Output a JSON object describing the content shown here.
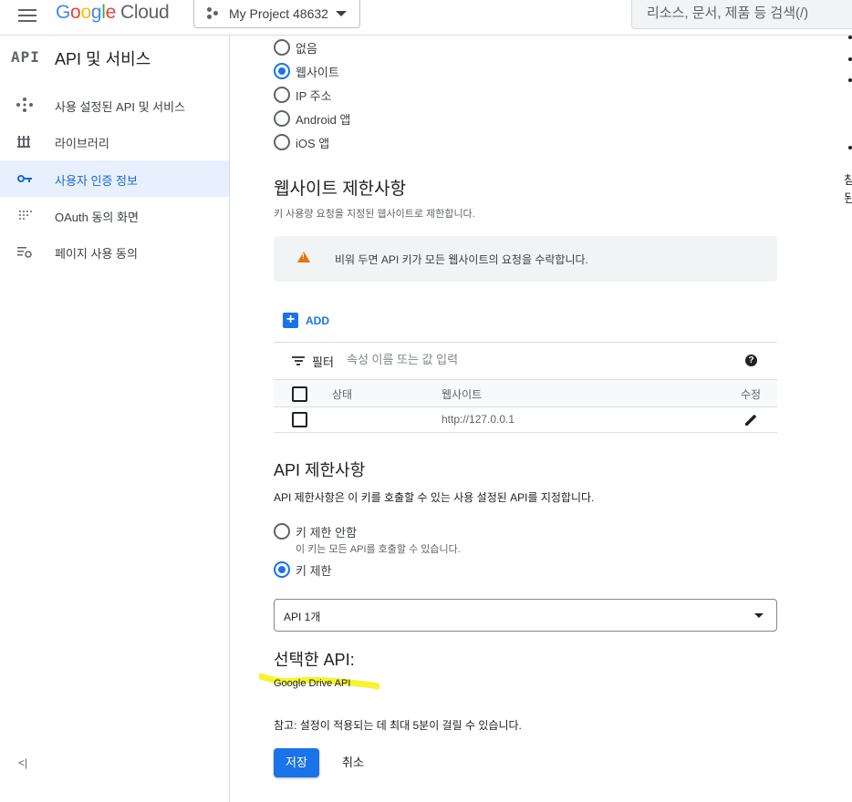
{
  "header": {
    "logo_google": [
      "G",
      "o",
      "o",
      "g",
      "l",
      "e"
    ],
    "logo_cloud": "Cloud",
    "project_name": "My Project 48632",
    "search_placeholder": "리소스, 문서, 제품 등 검색(/)"
  },
  "sidebar": {
    "badge": "API",
    "title": "API 및 서비스",
    "items": [
      {
        "label": "사용 설정된 API 및 서비스",
        "icon": "diamond-dots-icon"
      },
      {
        "label": "라이브러리",
        "icon": "library-icon"
      },
      {
        "label": "사용자 인증 정보",
        "icon": "key-icon",
        "active": true
      },
      {
        "label": "OAuth 동의 화면",
        "icon": "dotted-grid-icon"
      },
      {
        "label": "페이지 사용 동의",
        "icon": "settings-list-icon"
      }
    ],
    "collapse": "<|"
  },
  "app_restrictions": {
    "options": [
      {
        "label": "없음",
        "checked": false
      },
      {
        "label": "웹사이트",
        "checked": true
      },
      {
        "label": "IP 주소",
        "checked": false
      },
      {
        "label": "Android 앱",
        "checked": false
      },
      {
        "label": "iOS 앱",
        "checked": false
      }
    ]
  },
  "website_restrictions": {
    "title": "웹사이트 제한사항",
    "subtitle": "키 사용량 요청을 지정된 웹사이트로 제한합니다.",
    "warning": "비워 두면 API 키가 모든 웹사이트의 요청을 수락합니다.",
    "add_label": "ADD",
    "filter_label": "필터",
    "filter_placeholder": "속성 이름 또는 값 입력",
    "columns": {
      "status": "상태",
      "website": "웹사이트",
      "edit": "수정"
    },
    "rows": [
      {
        "status": "",
        "website": "http://127.0.0.1"
      }
    ]
  },
  "api_restrictions": {
    "title": "API 제한사항",
    "description": "API 제한사항은 이 키를 호출할 수 있는 사용 설정된 API를 지정합니다.",
    "option_none": "키 제한 안함",
    "option_none_help": "이 키는 모든 API를 호출할 수 있습니다.",
    "option_restrict": "키 제한",
    "selected_value": "API 1개",
    "selected_title": "선택한 API:",
    "selected_api": "Google Drive API",
    "highlight_color": "#f7f21a"
  },
  "footer": {
    "note": "참고: 설정이 적용되는 데 최대 5분이 걸릴 수 있습니다.",
    "save_label": "저장",
    "cancel_label": "취소"
  },
  "right_edge_text": [
    "침",
    "된"
  ]
}
